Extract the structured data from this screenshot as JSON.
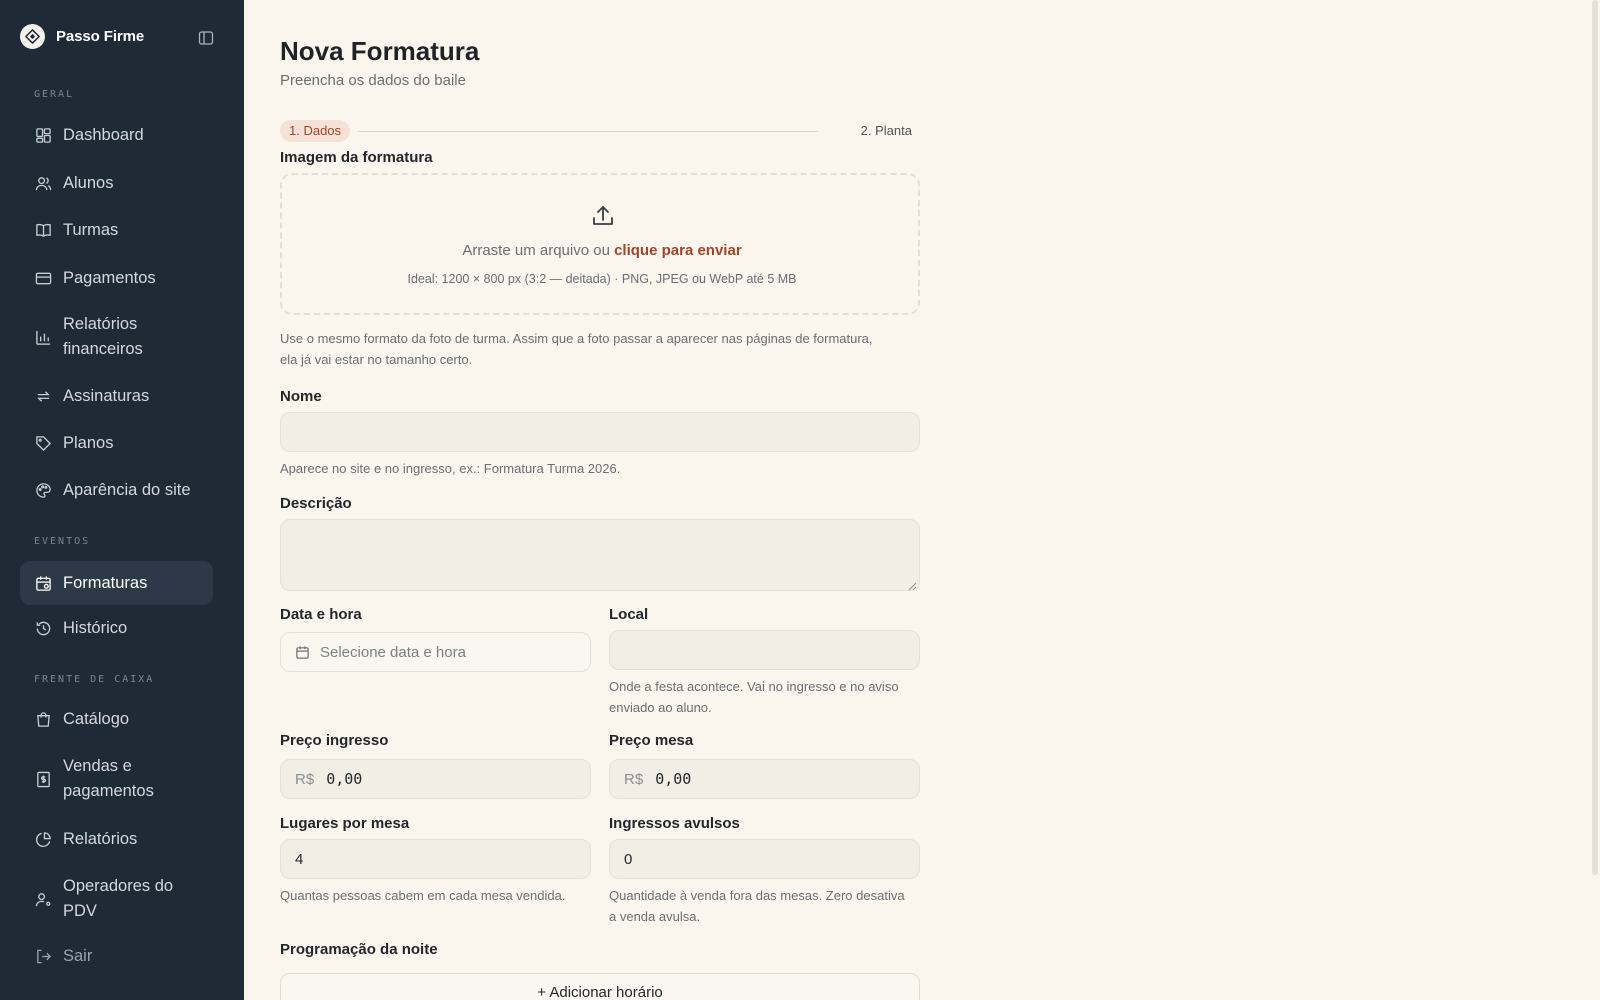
{
  "sidebar": {
    "brand": "Passo Firme",
    "sections": {
      "geral": "GERAL",
      "eventos": "EVENTOS",
      "frente_de_caixa": "FRENTE DE CAIXA"
    },
    "items": {
      "dashboard": "Dashboard",
      "alunos": "Alunos",
      "turmas": "Turmas",
      "pagamentos": "Pagamentos",
      "relatorios_financeiros_1": "Relatórios",
      "relatorios_financeiros_2": "financeiros",
      "assinaturas": "Assinaturas",
      "planos": "Planos",
      "aparencia": "Aparência do site",
      "formaturas": "Formaturas",
      "historico": "Histórico",
      "catalogo": "Catálogo",
      "vendas_1": "Vendas e",
      "vendas_2": "pagamentos",
      "relatorios": "Relatórios",
      "operadores_1": "Operadores do",
      "operadores_2": "PDV",
      "sair": "Sair"
    }
  },
  "page": {
    "title": "Nova Formatura",
    "subtitle": "Preencha os dados do baile"
  },
  "stepper": {
    "step1": "1. Dados",
    "step2": "2. Planta"
  },
  "form": {
    "image_label": "Imagem da formatura",
    "drop_text": "Arraste um arquivo ou ",
    "drop_link": "clique para enviar",
    "drop_hint": "Ideal: 1200 × 800 px (3:2 — deitada) · PNG, JPEG ou WebP até 5 MB",
    "image_help_1": "Use o mesmo formato da foto de turma. Assim que a foto passar a aparecer nas páginas de formatura,",
    "image_help_2": "ela já vai estar no tamanho certo.",
    "nome_label": "Nome",
    "nome_value": "",
    "nome_help": "Aparece no site e no ingresso, ex.: Formatura Turma 2026.",
    "descricao_label": "Descrição",
    "descricao_value": "",
    "data_label": "Data e hora",
    "data_placeholder": "Selecione data e hora",
    "local_label": "Local",
    "local_value": "",
    "local_help_1": "Onde a festa acontece. Vai no ingresso e no aviso",
    "local_help_2": "enviado ao aluno.",
    "preco_ingresso_label": "Preço ingresso",
    "preco_mesa_label": "Preço mesa",
    "currency": "R$",
    "preco_ingresso_value": "0,00",
    "preco_mesa_value": "0,00",
    "lugares_label": "Lugares por mesa",
    "lugares_value": "4",
    "lugares_help": "Quantas pessoas cabem em cada mesa vendida.",
    "avulsos_label": "Ingressos avulsos",
    "avulsos_value": "0",
    "avulsos_help_1": "Quantidade à venda fora das mesas. Zero desativa",
    "avulsos_help_2": "a venda avulsa.",
    "programacao_label": "Programação da noite",
    "add_horario": "+ Adicionar horário"
  },
  "colors": {
    "sidebar_bg": "#1f2a37",
    "page_bg": "#faf6ee",
    "accent": "#a3442a",
    "active_step_bg": "#f6e1d7"
  }
}
